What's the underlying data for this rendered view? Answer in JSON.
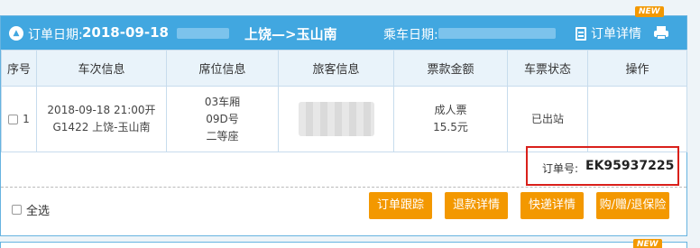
{
  "header": {
    "order_date_label": "订单日期:",
    "order_date": "2018-09-18",
    "route": "上饶—>玉山南",
    "ride_date_label": "乘车日期:",
    "detail_link": "订单详情",
    "new_badge": "NEW"
  },
  "table": {
    "columns": [
      "序号",
      "车次信息",
      "席位信息",
      "旅客信息",
      "票款金额",
      "车票状态",
      "操作"
    ],
    "row": {
      "index": "1",
      "train_line1": "2018-09-18 21:00开",
      "train_line2": "G1422 上饶-玉山南",
      "seat_line1": "03车厢",
      "seat_line2": "09D号",
      "seat_line3": "二等座",
      "fare_type": "成人票",
      "fare_amount": "15.5元",
      "status": "已出站",
      "operation": ""
    }
  },
  "order": {
    "number_label": "订单号:",
    "number": "EK95937225"
  },
  "footer": {
    "select_all": "全选",
    "buttons": [
      "订单跟踪",
      "退款详情",
      "快递详情",
      "购/赠/退保险"
    ]
  },
  "next_card": {
    "new_badge": "NEW"
  },
  "colors": {
    "header_bg": "#41a7e0",
    "button_bg": "#f39800",
    "highlight_border": "#d9201b"
  }
}
